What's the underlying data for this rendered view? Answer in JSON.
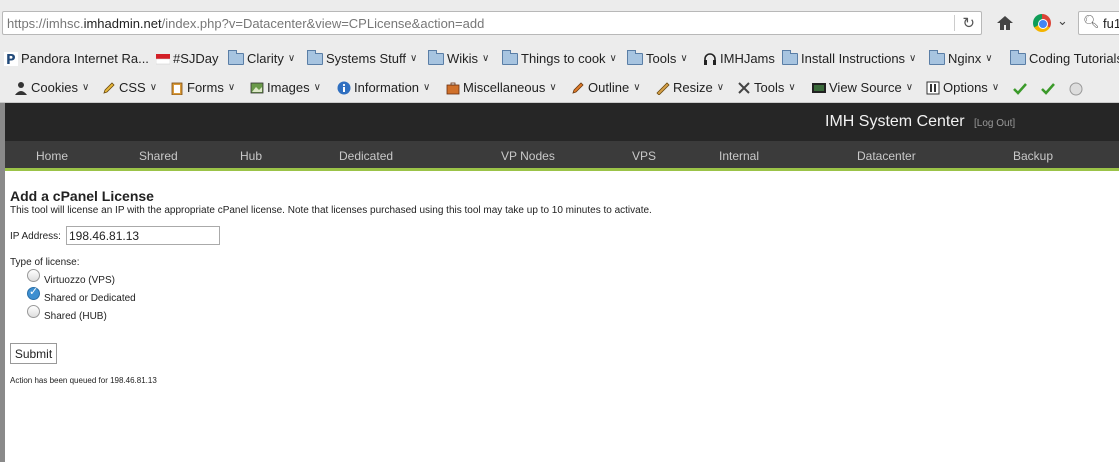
{
  "browser": {
    "url_prefix": "https://imhsc.",
    "url_host": "imhadmin.net",
    "url_rest": "/index.php?v=Datacenter&view=CPLicense&action=add",
    "search_value": "fu1"
  },
  "bookmarks": [
    {
      "label": "Pandora Internet Ra..."
    },
    {
      "label": "#SJDay"
    },
    {
      "label": "Clarity"
    },
    {
      "label": "Systems Stuff"
    },
    {
      "label": "Wikis"
    },
    {
      "label": "Things to cook"
    },
    {
      "label": "Tools"
    },
    {
      "label": "IMHJams"
    },
    {
      "label": "Install Instructions"
    },
    {
      "label": "Nginx"
    },
    {
      "label": "Coding Tutorials"
    }
  ],
  "webdev": [
    {
      "label": "Cookies"
    },
    {
      "label": "CSS"
    },
    {
      "label": "Forms"
    },
    {
      "label": "Images"
    },
    {
      "label": "Information"
    },
    {
      "label": "Miscellaneous"
    },
    {
      "label": "Outline"
    },
    {
      "label": "Resize"
    },
    {
      "label": "Tools"
    },
    {
      "label": "View Source"
    },
    {
      "label": "Options"
    }
  ],
  "header": {
    "system_name": "IMH System Center",
    "logout": "[Log Out]"
  },
  "nav": [
    "Home",
    "Shared",
    "Hub",
    "Dedicated",
    "VP Nodes",
    "VPS",
    "Internal",
    "Datacenter",
    "Backup"
  ],
  "form": {
    "title": "Add a cPanel License",
    "description": "This tool will license an IP with the appropriate cPanel license. Note that licenses purchased using this tool may take up to 10 minutes to activate.",
    "ip_label": "IP Address:",
    "ip_value": "198.46.81.13",
    "type_label": "Type of license:",
    "options": [
      "Virtuozzo (VPS)",
      "Shared or Dedicated",
      "Shared (HUB)"
    ],
    "selected": "Shared or Dedicated",
    "submit": "Submit",
    "status": "Action has been queued for 198.46.81.13"
  },
  "colors": {
    "header_bg": "#262626",
    "nav_bg": "#3b3b3b",
    "nav_accent": "#9bc348",
    "radio_checked": "#3d8fd1"
  }
}
